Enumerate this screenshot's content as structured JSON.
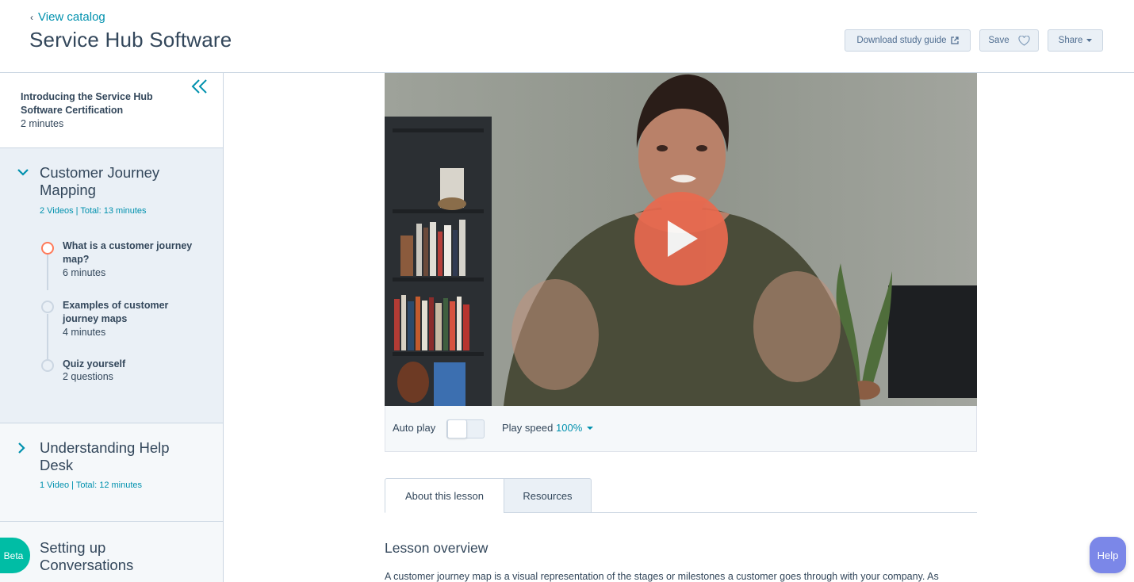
{
  "header": {
    "back_chevron": "‹",
    "back_label": "View catalog",
    "title": "Service Hub Software",
    "download_label": "Download study guide",
    "save_label": "Save",
    "share_label": "Share"
  },
  "sidebar": {
    "intro": {
      "title": "Introducing the Service Hub Software Certification",
      "duration": "2 minutes"
    },
    "sections": [
      {
        "title": "Customer Journey Mapping",
        "meta": "2 Videos | Total: 13 minutes",
        "expanded": true,
        "lessons": [
          {
            "title": "What is a customer journey map?",
            "duration": "6 minutes",
            "status": "current"
          },
          {
            "title": "Examples of customer journey maps",
            "duration": "4 minutes",
            "status": "not-started"
          },
          {
            "title": "Quiz yourself",
            "duration": "2 questions",
            "status": "not-started"
          }
        ]
      },
      {
        "title": "Understanding Help Desk",
        "meta": "1 Video | Total: 12 minutes",
        "expanded": false
      },
      {
        "title": "Setting up Conversations",
        "expanded": false
      }
    ],
    "beta_label": "Beta"
  },
  "player": {
    "autoplay_label": "Auto play",
    "autoplay_on": false,
    "speed_label": "Play speed",
    "speed_value": "100%"
  },
  "tabs": [
    {
      "label": "About this lesson",
      "active": true
    },
    {
      "label": "Resources",
      "active": false
    }
  ],
  "lesson": {
    "overview_title": "Lesson overview",
    "overview_text": "A customer journey map is a visual representation of the stages or milestones a customer goes through with your company. As"
  },
  "help_label": "Help",
  "colors": {
    "accent": "#0091ae",
    "play_button": "#e8694f",
    "active_lesson": "#ff7a59",
    "beta": "#00bda5",
    "help": "#7b87e8"
  },
  "icons": {
    "back": "chevron-left-icon",
    "external_link": "external-link-icon",
    "save": "heart-icon",
    "share": "caret-down-icon",
    "collapse": "double-chevron-left-icon",
    "play": "play-icon"
  }
}
